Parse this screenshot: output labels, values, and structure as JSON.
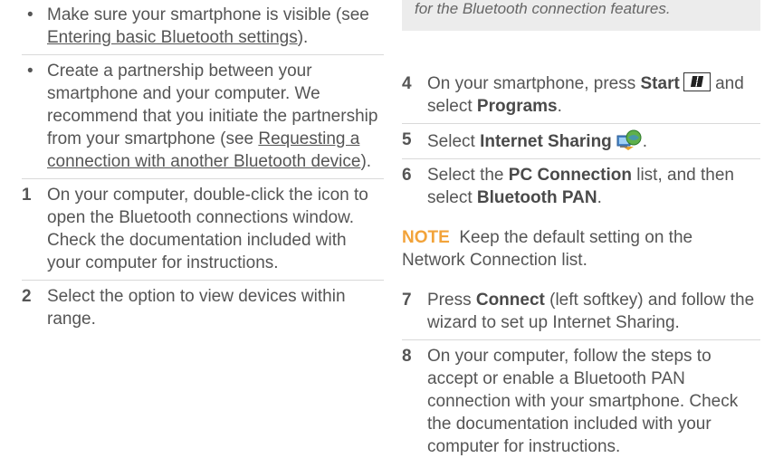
{
  "left": {
    "bullets": [
      {
        "pre": "Make sure your smartphone is visible (see ",
        "link": "Entering basic Bluetooth settings",
        "post": ")."
      },
      {
        "pre": "Create a partnership between your smartphone and your computer. We recommend that you initiate the partnership from your smartphone (see ",
        "link": "Requesting a connection with another Bluetooth device",
        "post": ")."
      }
    ],
    "steps": [
      {
        "num": "1",
        "text": "On your computer, double-click the icon to open the Bluetooth connections window. Check the documentation included with your computer for instructions."
      },
      {
        "num": "2",
        "text": "Select the option to view devices within range."
      }
    ]
  },
  "right": {
    "tip_text": "for the Bluetooth connection features.",
    "step4": {
      "num": "4",
      "pre": "On your smartphone, press ",
      "b1": "Start",
      "mid": " and select ",
      "b2": "Programs",
      "post": "."
    },
    "step5": {
      "num": "5",
      "pre": "Select ",
      "b1": "Internet Sharing",
      "post": "."
    },
    "step6": {
      "num": "6",
      "pre": "Select the ",
      "b1": "PC Connection",
      "mid": " list, and then select ",
      "b2": "Bluetooth PAN",
      "post": "."
    },
    "note": {
      "label": "NOTE",
      "text": "Keep the default setting on the Network Connection list."
    },
    "step7": {
      "num": "7",
      "pre": "Press ",
      "b1": "Connect",
      "post": " (left softkey) and follow the wizard to set up Internet Sharing."
    },
    "step8": {
      "num": "8",
      "text": "On your computer, follow the steps to accept or enable a Bluetooth PAN connection with your smartphone. Check the documentation included with your computer for instructions."
    }
  },
  "colors": {
    "body_text": "#555555",
    "note_label": "#f2a33a",
    "tip_background": "#ececec"
  },
  "icons": [
    "windows-start-key-icon",
    "internet-sharing-icon"
  ]
}
